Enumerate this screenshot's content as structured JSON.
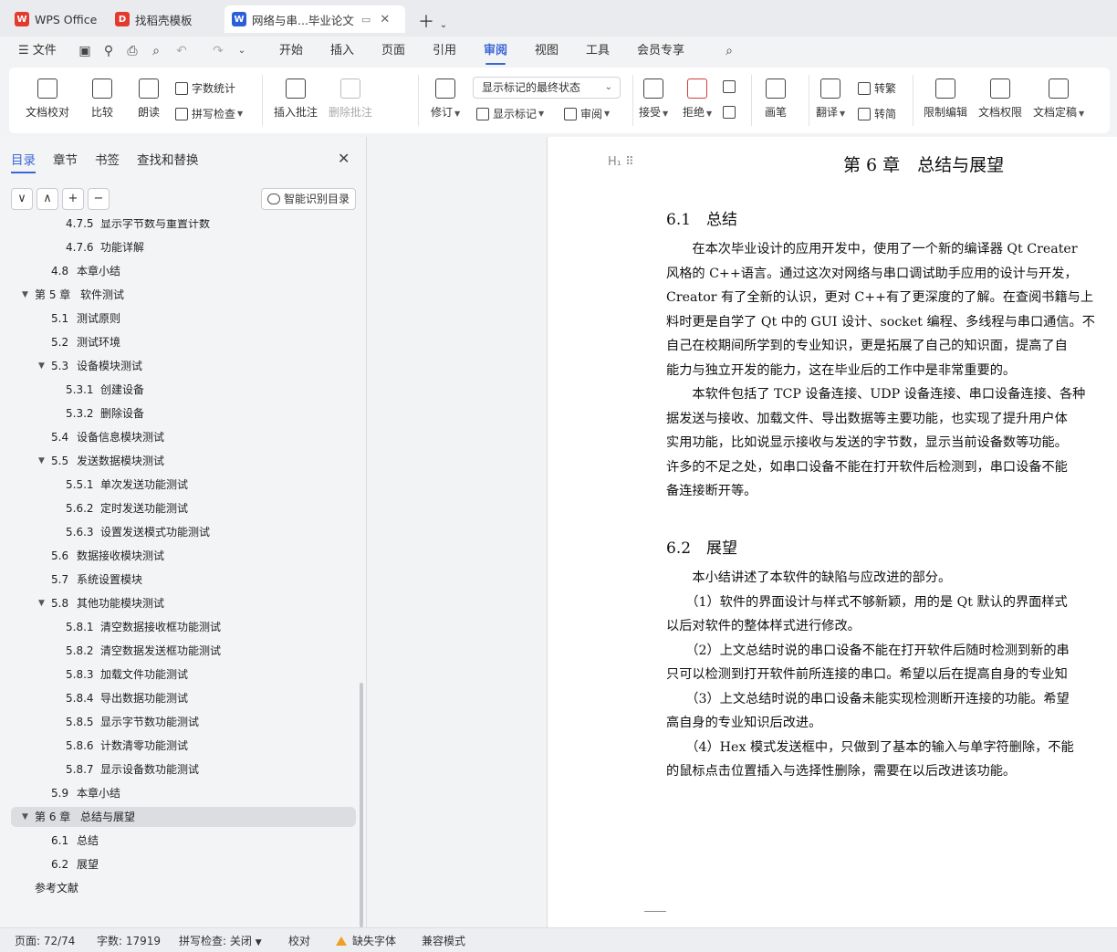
{
  "tabs": [
    {
      "label": "WPS Office",
      "icon": "wps-logo-icon",
      "color": "#e23b2e"
    },
    {
      "label": "找稻壳模板",
      "icon": "docer-icon",
      "color": "#e23b2e"
    },
    {
      "label": "网络与串...毕业论文",
      "icon": "word-doc-icon",
      "color": "#2b5fd9"
    }
  ],
  "menu": {
    "file": "文件",
    "items": [
      "开始",
      "插入",
      "页面",
      "引用",
      "审阅",
      "视图",
      "工具",
      "会员专享"
    ],
    "active": "审阅"
  },
  "ribbon": {
    "doc_check": "文档校对",
    "compare": "比较",
    "read_aloud": "朗读",
    "word_count": "字数统计",
    "spell_check": "拼写检查",
    "insert_comment": "插入批注",
    "delete_comment": "删除批注",
    "revise": "修订",
    "markup_state": "显示标记的最终状态",
    "show_markup": "显示标记",
    "review": "审阅",
    "accept": "接受",
    "reject": "拒绝",
    "pen": "画笔",
    "translate": "翻译",
    "to_traditional": "转繁",
    "to_simplified": "转简",
    "restrict_edit": "限制编辑",
    "doc_permission": "文档权限",
    "doc_finalize": "文档定稿"
  },
  "nav": {
    "tabs": [
      "目录",
      "章节",
      "书签",
      "查找和替换"
    ],
    "smart_toc": "智能识别目录",
    "buttons": [
      "∨",
      "∧",
      "+",
      "−"
    ],
    "toc": [
      {
        "num": "4.7.5",
        "title": "显示字节数与重置计数",
        "level": 3,
        "cut": true
      },
      {
        "num": "4.7.6",
        "title": "功能详解",
        "level": 3
      },
      {
        "num": "4.8",
        "title": "本章小结",
        "level": 2
      },
      {
        "num": "第 5 章",
        "title": "软件测试",
        "level": 1,
        "expanded": true
      },
      {
        "num": "5.1",
        "title": "测试原则",
        "level": 2
      },
      {
        "num": "5.2",
        "title": "测试环境",
        "level": 2
      },
      {
        "num": "5.3",
        "title": "设备模块测试",
        "level": 2,
        "expanded": true
      },
      {
        "num": "5.3.1",
        "title": "创建设备",
        "level": 3
      },
      {
        "num": "5.3.2",
        "title": "删除设备",
        "level": 3
      },
      {
        "num": "5.4",
        "title": "设备信息模块测试",
        "level": 2
      },
      {
        "num": "5.5",
        "title": "发送数据模块测试",
        "level": 2,
        "expanded": true
      },
      {
        "num": "5.5.1",
        "title": "单次发送功能测试",
        "level": 3
      },
      {
        "num": "5.6.2",
        "title": "定时发送功能测试",
        "level": 3
      },
      {
        "num": "5.6.3",
        "title": "设置发送模式功能测试",
        "level": 3
      },
      {
        "num": "5.6",
        "title": "数据接收模块测试",
        "level": 2
      },
      {
        "num": "5.7",
        "title": "系统设置模块",
        "level": 2
      },
      {
        "num": "5.8",
        "title": "其他功能模块测试",
        "level": 2,
        "expanded": true
      },
      {
        "num": "5.8.1",
        "title": "清空数据接收框功能测试",
        "level": 3
      },
      {
        "num": "5.8.2",
        "title": "清空数据发送框功能测试",
        "level": 3
      },
      {
        "num": "5.8.3",
        "title": "加载文件功能测试",
        "level": 3
      },
      {
        "num": "5.8.4",
        "title": "导出数据功能测试",
        "level": 3
      },
      {
        "num": "5.8.5",
        "title": "显示字节数功能测试",
        "level": 3
      },
      {
        "num": "5.8.6",
        "title": "计数清零功能测试",
        "level": 3
      },
      {
        "num": "5.8.7",
        "title": "显示设备数功能测试",
        "level": 3
      },
      {
        "num": "5.9",
        "title": "本章小结",
        "level": 2
      },
      {
        "num": "第 6 章",
        "title": "总结与展望",
        "level": 1,
        "expanded": true,
        "selected": true
      },
      {
        "num": "6.1",
        "title": "总结",
        "level": 2
      },
      {
        "num": "6.2",
        "title": "展望",
        "level": 2
      },
      {
        "num": "",
        "title": "参考文献",
        "level": 1
      }
    ]
  },
  "document": {
    "chapter_title": "第 6 章　总结与展望",
    "section1": "6.1　总结",
    "section1_lines": [
      "　　在本次毕业设计的应用开发中，使用了一个新的编译器 Qt Creater",
      "风格的 C++语言。通过这次对网络与串口调试助手应用的设计与开发，",
      "Creator 有了全新的认识，更对 C++有了更深度的了解。在查阅书籍与上",
      "料时更是自学了 Qt 中的 GUI 设计、socket 编程、多线程与串口通信。不",
      "自己在校期间所学到的专业知识，更是拓展了自己的知识面，提高了自",
      "能力与独立开发的能力，这在毕业后的工作中是非常重要的。",
      "　　本软件包括了 TCP 设备连接、UDP 设备连接、串口设备连接、各种",
      "据发送与接收、加载文件、导出数据等主要功能，也实现了提升用户体",
      "实用功能，比如说显示接收与发送的字节数，显示当前设备数等功能。",
      "许多的不足之处，如串口设备不能在打开软件后检测到，串口设备不能",
      "备连接断开等。"
    ],
    "section2": "6.2　展望",
    "section2_lines": [
      "　　本小结讲述了本软件的缺陷与应改进的部分。",
      "　　（1）软件的界面设计与样式不够新颖，用的是 Qt 默认的界面样式",
      "以后对软件的整体样式进行修改。",
      "　　（2）上文总结时说的串口设备不能在打开软件后随时检测到新的串",
      "只可以检测到打开软件前所连接的串口。希望以后在提高自身的专业知",
      "　　（3）上文总结时说的串口设备未能实现检测断开连接的功能。希望",
      "高自身的专业知识后改进。",
      "　　（4）Hex 模式发送框中，只做到了基本的输入与单字符删除，不能",
      "的鼠标点击位置插入与选择性删除，需要在以后改进该功能。"
    ]
  },
  "status": {
    "page": "页面: 72/74",
    "words": "字数: 17919",
    "spell": "拼写检查: 关闭",
    "proof": "校对",
    "missing_font": "缺失字体",
    "compat": "兼容模式"
  },
  "colors": {
    "accent": "#3b66d6",
    "warning": "#f0a020"
  }
}
